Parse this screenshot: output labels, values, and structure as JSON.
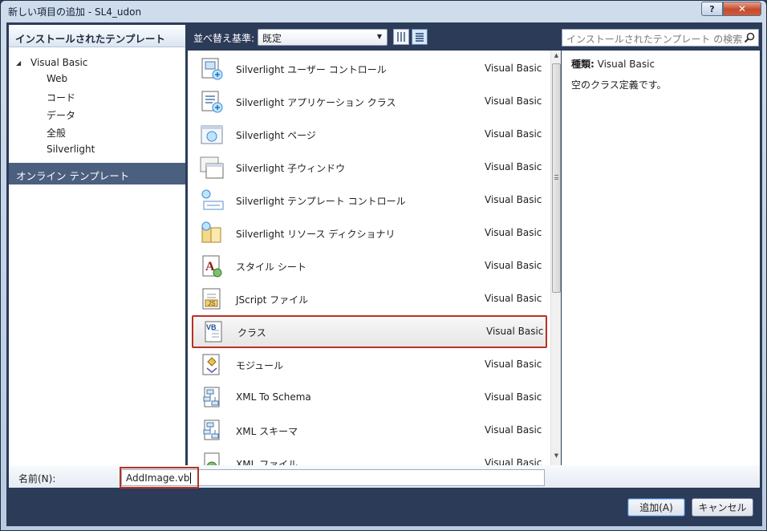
{
  "window": {
    "title": "新しい項目の追加 - SL4_udon",
    "help_label": "?",
    "close_label": "✕"
  },
  "left_panel": {
    "header": "インストールされたテンプレート",
    "root": "Visual Basic",
    "children": [
      "Web",
      "コード",
      "データ",
      "全般",
      "Silverlight"
    ],
    "online": "オンライン テンプレート"
  },
  "toolbar": {
    "sort_label": "並べ替え基準:",
    "sort_value": "既定",
    "search_placeholder": "インストールされたテンプレート の検索"
  },
  "items": [
    {
      "name": "Silverlight ユーザー コントロール",
      "lang": "Visual Basic",
      "icon": "user-control-icon"
    },
    {
      "name": "Silverlight アプリケーション クラス",
      "lang": "Visual Basic",
      "icon": "application-class-icon"
    },
    {
      "name": "Silverlight ページ",
      "lang": "Visual Basic",
      "icon": "page-icon"
    },
    {
      "name": "Silverlight 子ウィンドウ",
      "lang": "Visual Basic",
      "icon": "child-window-icon"
    },
    {
      "name": "Silverlight テンプレート コントロール",
      "lang": "Visual Basic",
      "icon": "templated-control-icon"
    },
    {
      "name": "Silverlight リソース ディクショナリ",
      "lang": "Visual Basic",
      "icon": "resource-dictionary-icon"
    },
    {
      "name": "スタイル シート",
      "lang": "Visual Basic",
      "icon": "style-sheet-icon"
    },
    {
      "name": "JScript ファイル",
      "lang": "Visual Basic",
      "icon": "jscript-file-icon"
    },
    {
      "name": "クラス",
      "lang": "Visual Basic",
      "icon": "vb-class-icon",
      "selected": true
    },
    {
      "name": "モジュール",
      "lang": "Visual Basic",
      "icon": "module-icon"
    },
    {
      "name": "XML To Schema",
      "lang": "Visual Basic",
      "icon": "xml-to-schema-icon"
    },
    {
      "name": "XML スキーマ",
      "lang": "Visual Basic",
      "icon": "xml-schema-icon"
    },
    {
      "name": "XML ファイル",
      "lang": "Visual Basic",
      "icon": "xml-file-icon"
    }
  ],
  "details": {
    "type_label": "種類:",
    "type_value": "Visual Basic",
    "description": "空のクラス定義です。"
  },
  "name_field": {
    "label": "名前(N):",
    "value": "AddImage.vb"
  },
  "buttons": {
    "add": "追加(A)",
    "cancel": "キャンセル"
  },
  "colors": {
    "highlight_border": "#b73222",
    "dialog_background": "#2c3b58",
    "online_selected": "#4b5f7f"
  }
}
